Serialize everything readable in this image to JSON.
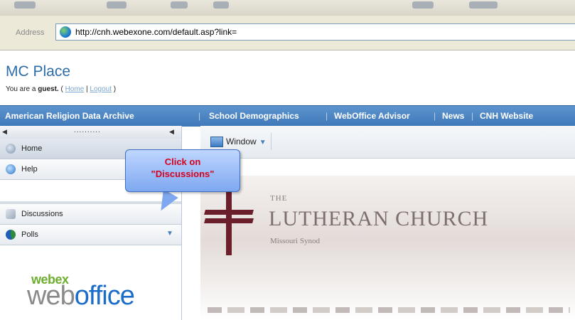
{
  "browser": {
    "address_label": "Address",
    "address_url": "http://cnh.webexone.com/default.asp?link="
  },
  "header": {
    "site_title": "MC Place",
    "guest_prefix": "You are a ",
    "guest_word": "guest.",
    "guest_mid": " ( ",
    "home_link": "Home",
    "pipe": " | ",
    "logout_link": "Logout",
    "guest_end": " )"
  },
  "navbar": {
    "items": [
      "American Religion Data Archive",
      "School Demographics",
      "WebOffice Advisor",
      "News",
      "CNH Website"
    ],
    "separator": "|"
  },
  "sidebar": {
    "top_dots": "..........",
    "items": [
      {
        "label": "Home",
        "icon": "home-icon"
      },
      {
        "label": "Help",
        "icon": "help-icon"
      },
      {
        "label": "Discussions",
        "icon": "discussions-icon"
      },
      {
        "label": "Polls",
        "icon": "polls-icon"
      }
    ]
  },
  "logo": {
    "webex": "webex",
    "web": "web",
    "office": "office"
  },
  "content": {
    "window_label": "Window",
    "banner_the": "THE",
    "banner_name": "LUTHERAN CHURCH",
    "banner_synod": "Missouri Synod"
  },
  "callout": {
    "line1": "Click on",
    "line2": "\"Discussions\""
  }
}
